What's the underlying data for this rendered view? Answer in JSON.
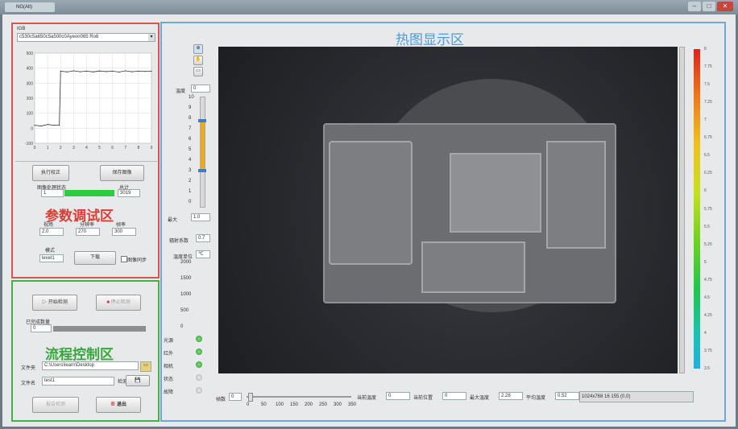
{
  "window": {
    "title": "NG(Alt)"
  },
  "colors": {
    "red": "#d9534f",
    "green": "#45b04a",
    "blue": "#6ea8d9"
  },
  "regions": {
    "param": "参数调试区",
    "flow": "流程控制区",
    "heat": "热图显示区"
  },
  "camera": {
    "label": "IGB",
    "value": "c530c5a650c5a500c0Ayeon065 Ro6"
  },
  "chart_data": {
    "type": "line",
    "title": "",
    "xlabel": "",
    "ylabel": "",
    "y_ticks": [
      "500",
      "400",
      "300",
      "200",
      "100",
      "0",
      "-100"
    ],
    "x_ticks": [
      "0",
      "1",
      "2",
      "3",
      "4",
      "5",
      "6",
      "7",
      "8",
      "9"
    ],
    "ylim": [
      -100,
      500
    ],
    "xlim": [
      0,
      9
    ],
    "series": [
      {
        "x": [
          0,
          0.5,
          1,
          1.5,
          1.9,
          2,
          2.5,
          3,
          3.5,
          4,
          4.5,
          5,
          5.5,
          6,
          6.5,
          7,
          7.5,
          8,
          8.5,
          9
        ],
        "values": [
          20,
          15,
          25,
          20,
          20,
          380,
          375,
          382,
          376,
          380,
          375,
          381,
          377,
          380,
          374,
          382,
          376,
          380,
          378,
          380
        ]
      }
    ]
  },
  "buttons": {
    "calib": "执行校正",
    "save_image": "保存图像",
    "download": "下载",
    "start": "开始检测",
    "stop": "停止检测",
    "report": "报告检测",
    "exit": "退出"
  },
  "params": {
    "progress_label": "图像处理状态",
    "progress_value": "1",
    "total_label": "总计",
    "total_value": "3019",
    "p1_label": "视场",
    "p2_label": "分辨率",
    "p3_label": "帧率",
    "p1": "2.0",
    "p2": "270",
    "p3": "300",
    "mode_label": "模式",
    "mode_value": "level1",
    "checkbox_label": "图像同步"
  },
  "flow": {
    "count_label": "已完成数量",
    "count_value": "0",
    "path_label": "文件夹",
    "path_value": "C:\\Users\\learn\\Desktop",
    "file_label": "文件名",
    "file_value": "test1",
    "check_label": "检测"
  },
  "heatmap": {
    "temp_label": "温度",
    "temp_value": "0",
    "scale_ticks": [
      "10",
      "9",
      "8",
      "7",
      "6",
      "5",
      "4",
      "3",
      "2",
      "1",
      "0"
    ],
    "max_label": "最大",
    "max_value": "1.0",
    "emiss_label": "辐射系数",
    "emiss_value": "0.7",
    "unit_label": "温度单位",
    "unit_value": "℃",
    "side_ticks": [
      "2000",
      "1500",
      "1000",
      "500",
      "0"
    ],
    "leds": [
      {
        "label": "光源",
        "on": true
      },
      {
        "label": "红外",
        "on": true
      },
      {
        "label": "相机",
        "on": true
      },
      {
        "label": "状态",
        "on": false
      },
      {
        "label": "故障",
        "on": false
      }
    ],
    "colorbar_ticks": [
      "8",
      "7.75",
      "7.5",
      "7.25",
      "7",
      "6.75",
      "6.5",
      "6.25",
      "6",
      "5.75",
      "5.5",
      "5.25",
      "5",
      "4.75",
      "4.5",
      "4.25",
      "4",
      "3.75",
      "3.5"
    ],
    "bottom_ticks": [
      "0",
      "50",
      "100",
      "150",
      "200",
      "250",
      "300",
      "350"
    ],
    "frame_label": "帧数",
    "frame_value": "0",
    "stats": [
      {
        "label": "当前温度",
        "value": "0"
      },
      {
        "label": "当前位置",
        "value": "0"
      },
      {
        "label": "最大温度",
        "value": "2.28"
      },
      {
        "label": "平均温度",
        "value": "0.52"
      }
    ],
    "info": "1024x768 16 155 (0,0)"
  }
}
